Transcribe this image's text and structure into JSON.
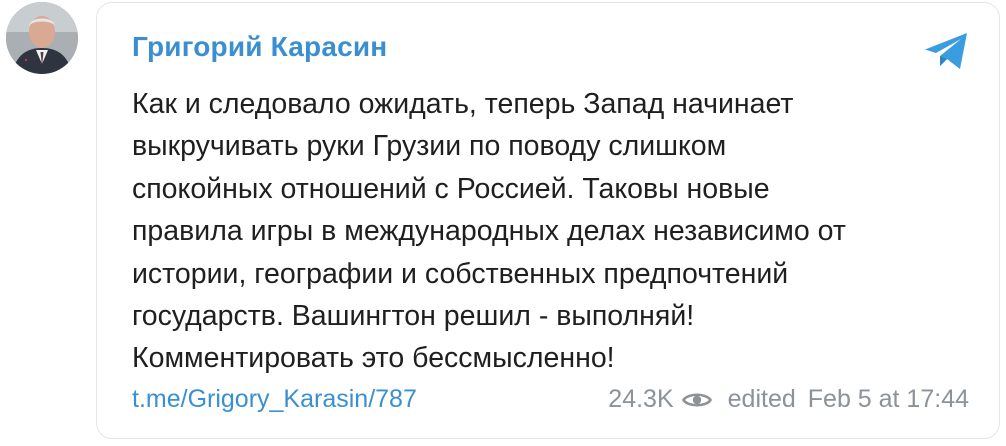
{
  "post": {
    "author": "Григорий Карасин",
    "message": "Как и следовало ожидать, теперь Запад начинает\nвыкручивать руки Грузии по поводу слишком\nспокойных отношений с Россией. Таковы новые\nправила игры в международных делах независимо от\nистории, географии и собственных предпочтений\nгосударств. Вашингтон решил - выполняй!\nКомментировать это бессмысленно!",
    "link": "t.me/Grigory_Karasin/787",
    "views": "24.3K",
    "edited_label": "edited",
    "timestamp": "Feb 5 at 17:44"
  },
  "icons": {
    "brand": "telegram-icon",
    "views": "eye-icon",
    "avatar": "author-photo"
  },
  "colors": {
    "accent": "#3a8fd0",
    "text": "#1f1f1f",
    "muted": "#8b9299",
    "border": "#e3e6ea"
  }
}
